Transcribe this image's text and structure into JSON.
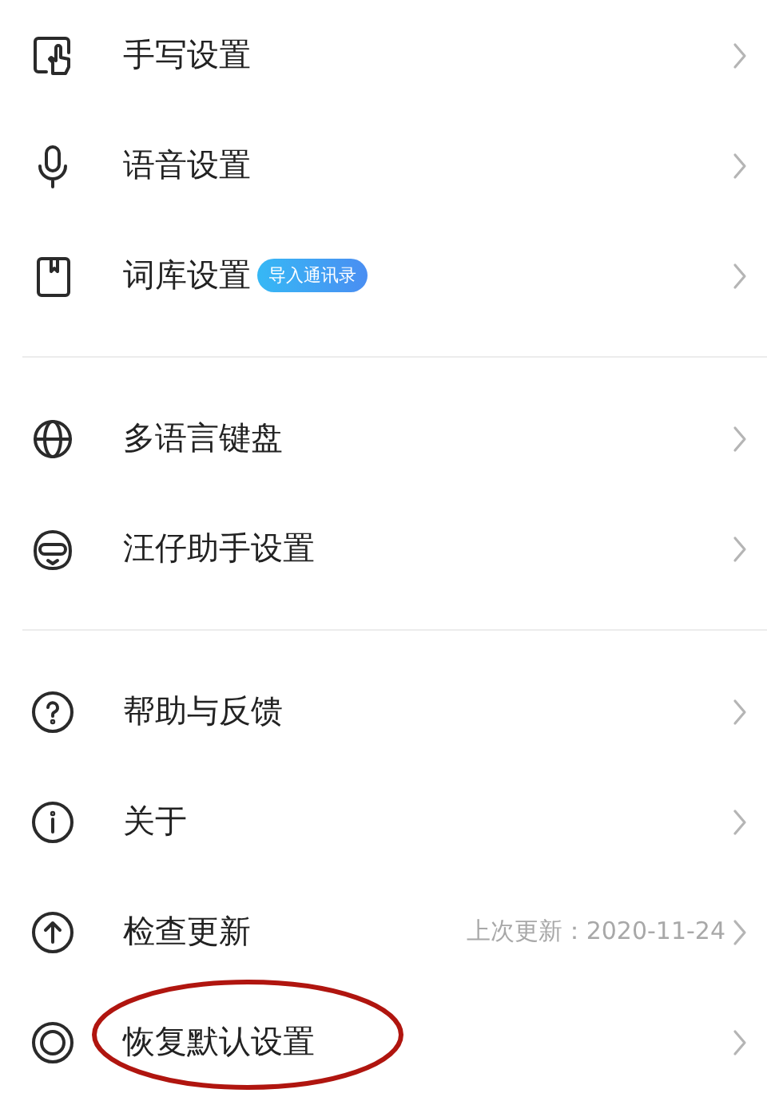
{
  "groups": [
    {
      "items": [
        {
          "kind": "handwriting",
          "label": "手写设置"
        },
        {
          "kind": "microphone",
          "label": "语音设置"
        },
        {
          "kind": "book",
          "label": "词库设置",
          "badge": "导入通讯录"
        }
      ]
    },
    {
      "items": [
        {
          "kind": "globe",
          "label": "多语言键盘"
        },
        {
          "kind": "mascot",
          "label": "汪仔助手设置"
        }
      ]
    },
    {
      "items": [
        {
          "kind": "help",
          "label": "帮助与反馈"
        },
        {
          "kind": "info",
          "label": "关于"
        },
        {
          "kind": "update",
          "label": "检查更新",
          "value": "上次更新：2020-11-24"
        },
        {
          "kind": "restore",
          "label": "恢复默认设置",
          "circled": true
        }
      ]
    }
  ]
}
